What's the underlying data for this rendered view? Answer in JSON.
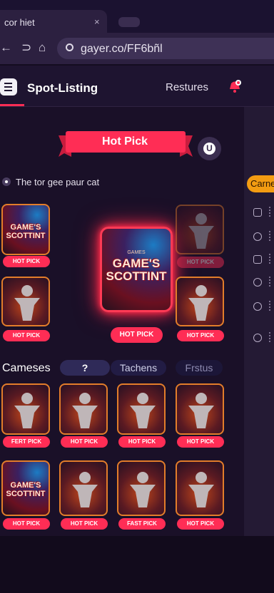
{
  "browser": {
    "tab_title": "cor hiet",
    "tab_close": "×",
    "back_icon": "←",
    "forward_icon": "⊃",
    "home_icon": "⌂",
    "url": "gayer.co/FF6bñl"
  },
  "header": {
    "title": "Spot-Listing",
    "features_link": "Restures",
    "menu_icon": "menu-icon",
    "bell_icon": "bell-icon"
  },
  "featured": {
    "ribbon": "Hot Pick",
    "avatar_letter": "U",
    "tagline": "The tor gee paur cat",
    "main_badge": "HOT PICK",
    "poster_title": "GAME'S SCOTTINT",
    "poster_subtitle": "GAMES"
  },
  "left_cards": [
    {
      "type": "poster",
      "title": "GAME'S SCOTTINT",
      "badge": "HOT PICK"
    },
    {
      "type": "figure",
      "badge": "HOT PICK"
    }
  ],
  "right_cards": [
    {
      "type": "figure",
      "badge": "HOT PICK",
      "dim": true
    },
    {
      "type": "figure",
      "badge": "HOT PICK"
    }
  ],
  "filters": {
    "label": "Cameses",
    "pills": [
      "?",
      "Tachens",
      "Frstus"
    ]
  },
  "grid_row1": [
    {
      "type": "figure",
      "badge": "FERT PICK"
    },
    {
      "type": "figure",
      "badge": "HOT PICK"
    },
    {
      "type": "figure",
      "badge": "HOT PICK"
    },
    {
      "type": "figure",
      "badge": "HOT PICK"
    }
  ],
  "grid_row2": [
    {
      "type": "poster",
      "title": "GAME'S SCOTTINT",
      "badge": "HOT PICK"
    },
    {
      "type": "figure",
      "badge": "HOT PICK"
    },
    {
      "type": "figure",
      "badge": "FAST PICK"
    },
    {
      "type": "figure",
      "badge": "HOT PICK"
    }
  ],
  "sidebar": {
    "button_label": "Carne"
  },
  "colors": {
    "accent": "#ff2d55",
    "card_border": "#e37d2a",
    "side_button": "#f39c12",
    "background": "#1a1028"
  }
}
